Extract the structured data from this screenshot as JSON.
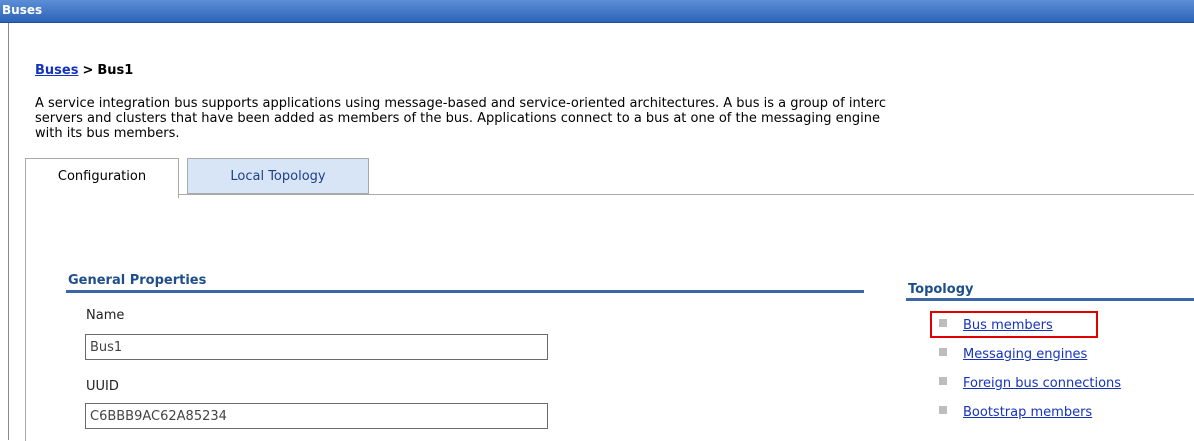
{
  "window": {
    "title": "Buses"
  },
  "breadcrumb": {
    "parent": "Buses",
    "separator": ">",
    "current": "Bus1"
  },
  "description": {
    "lines": [
      "A service integration bus supports applications using message-based and service-oriented architectures. A bus is a group of interc",
      "servers and clusters that have been added as members of the bus. Applications connect to a bus at one of the messaging engine",
      "with its bus members."
    ]
  },
  "tabs": [
    {
      "label": "Configuration",
      "active": true
    },
    {
      "label": "Local Topology",
      "active": false
    }
  ],
  "general_properties": {
    "title": "General Properties",
    "name_label": "Name",
    "name_value": "Bus1",
    "uuid_label": "UUID",
    "uuid_value": "C6BBB9AC62A85234"
  },
  "topology": {
    "title": "Topology",
    "links": [
      {
        "label": "Bus members",
        "highlighted": true
      },
      {
        "label": "Messaging engines",
        "highlighted": false
      },
      {
        "label": "Foreign bus connections",
        "highlighted": false
      },
      {
        "label": "Bootstrap members",
        "highlighted": false
      }
    ]
  },
  "colors": {
    "title_bar": "#2e64b8",
    "link": "#1533bd",
    "section_title": "#1f4f8a",
    "highlight": "#e00000",
    "inactive_tab": "#d8e5f6"
  }
}
